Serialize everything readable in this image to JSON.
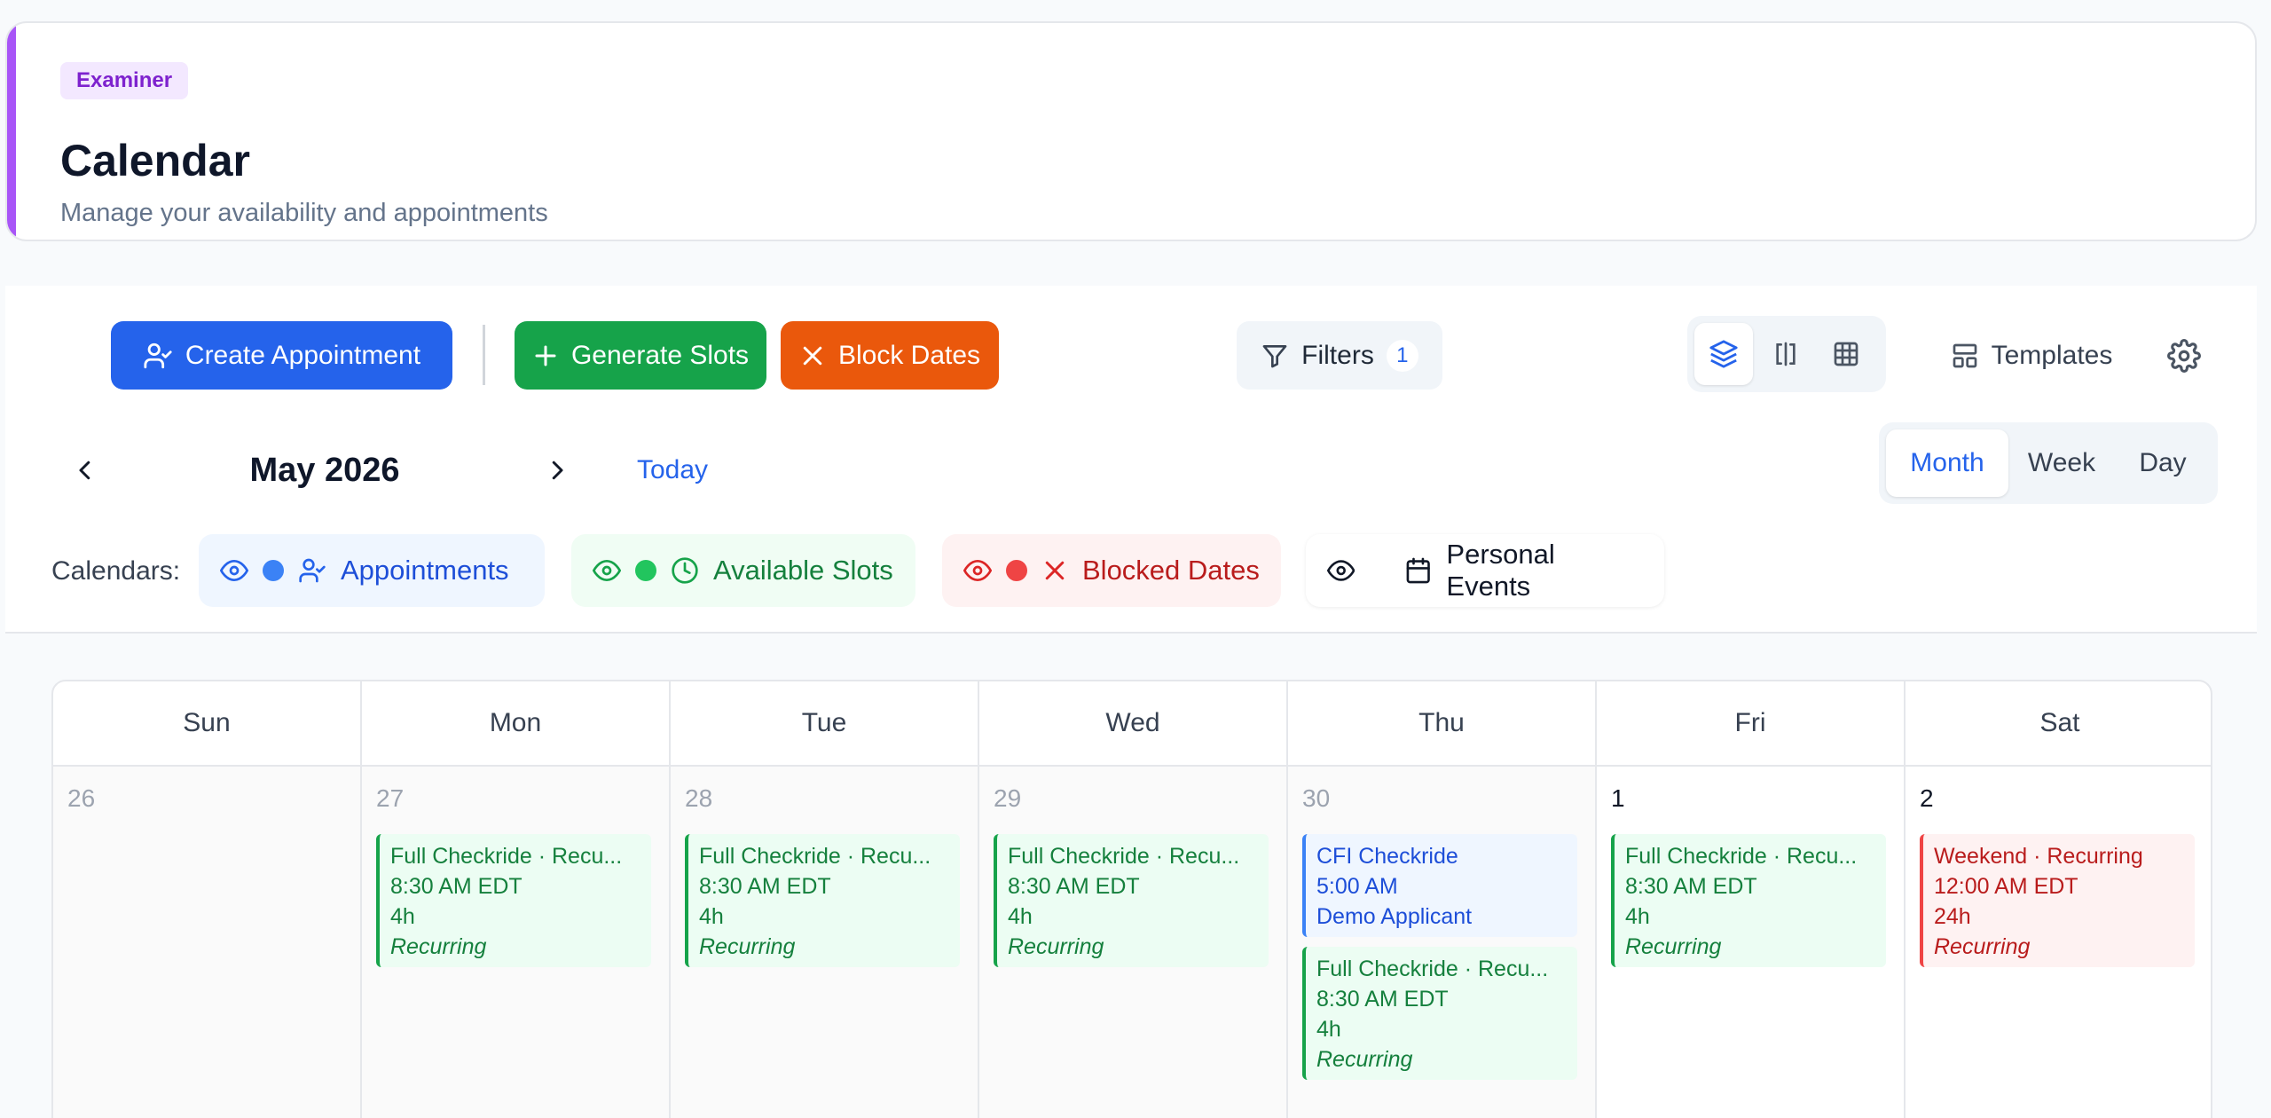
{
  "header": {
    "role_badge": "Examiner",
    "title": "Calendar",
    "subtitle": "Manage your availability and appointments"
  },
  "toolbar": {
    "create_label": "Create Appointment",
    "generate_label": "Generate Slots",
    "block_label": "Block Dates",
    "filters_label": "Filters",
    "filters_count": "1",
    "templates_label": "Templates"
  },
  "nav": {
    "month": "May 2026",
    "today_label": "Today",
    "modes": [
      "Month",
      "Week",
      "Day"
    ],
    "active_mode": "Month"
  },
  "calendars": {
    "label": "Calendars:",
    "items": [
      {
        "label": "Appointments",
        "color": "#3b82f6"
      },
      {
        "label": "Available Slots",
        "color": "#22c55e"
      },
      {
        "label": "Blocked Dates",
        "color": "#ef4444"
      },
      {
        "label": "Personal Events"
      }
    ]
  },
  "grid": {
    "weekdays": [
      "Sun",
      "Mon",
      "Tue",
      "Wed",
      "Thu",
      "Fri",
      "Sat"
    ],
    "days": [
      {
        "num": "26",
        "events": []
      },
      {
        "num": "27",
        "events": [
          {
            "title": "Full Checkride · Recu...",
            "time": "8:30 AM EDT",
            "detail": "4h",
            "note": "Recurring",
            "kind": "green"
          }
        ]
      },
      {
        "num": "28",
        "events": [
          {
            "title": "Full Checkride · Recu...",
            "time": "8:30 AM EDT",
            "detail": "4h",
            "note": "Recurring",
            "kind": "green"
          }
        ]
      },
      {
        "num": "29",
        "events": [
          {
            "title": "Full Checkride · Recu...",
            "time": "8:30 AM EDT",
            "detail": "4h",
            "note": "Recurring",
            "kind": "green"
          }
        ]
      },
      {
        "num": "30",
        "events": [
          {
            "title": "CFI Checkride",
            "time": "5:00 AM",
            "detail": "Demo Applicant",
            "note": "",
            "kind": "blue"
          },
          {
            "title": "Full Checkride · Recu...",
            "time": "8:30 AM EDT",
            "detail": "4h",
            "note": "Recurring",
            "kind": "green"
          }
        ]
      },
      {
        "num": "1",
        "events": [
          {
            "title": "Full Checkride · Recu...",
            "time": "8:30 AM EDT",
            "detail": "4h",
            "note": "Recurring",
            "kind": "green"
          }
        ]
      },
      {
        "num": "2",
        "events": [
          {
            "title": "Weekend · Recurring",
            "time": "12:00 AM EDT",
            "detail": "24h",
            "note": "Recurring",
            "kind": "red"
          }
        ]
      }
    ]
  },
  "colors": {
    "accent_purple": "#a855f7",
    "primary_blue": "#2563eb",
    "green": "#16a34a",
    "orange": "#ea580c",
    "red": "#ef4444"
  }
}
